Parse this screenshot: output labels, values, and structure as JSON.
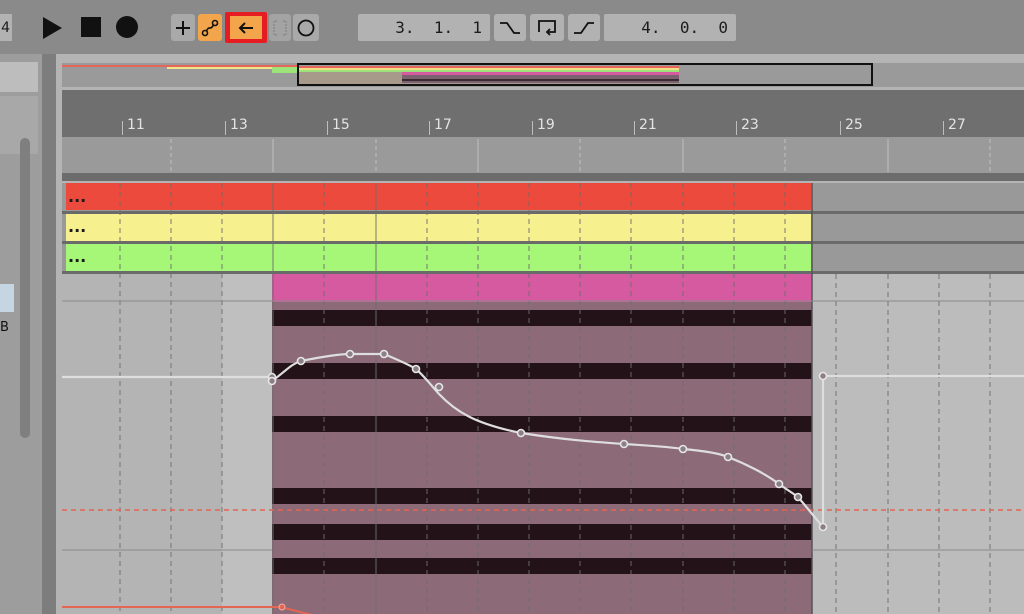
{
  "transport": {
    "meter_fragment": "4",
    "play_icon": "play-icon",
    "stop_icon": "stop-icon",
    "record_icon": "record-icon",
    "add_icon": "plus-icon",
    "automation_icon": "automation-draw-icon",
    "back_to_arrangement_icon": "arrow-left-icon",
    "punch_icon": "punch-bracket-icon",
    "loop_icon": "circle-icon",
    "position": "3.  1.  1",
    "punch_in_icon": "punch-in-icon",
    "loop_switch_icon": "loop-switch-icon",
    "punch_out_icon": "punch-out-icon",
    "length": "4.  0.  0",
    "highlight_color": "#e61c23",
    "active_color": "#f2a54a"
  },
  "left_strip": {
    "label": "B"
  },
  "ruler": {
    "bars": [
      "11",
      "13",
      "15",
      "17",
      "19",
      "21",
      "23",
      "25",
      "27"
    ]
  },
  "tracks": [
    {
      "label": "...",
      "color": "#ec4a3c"
    },
    {
      "label": "...",
      "color": "#f6f08f"
    },
    {
      "label": "...",
      "color": "#a6f778"
    }
  ],
  "clip": {
    "header_color": "#d55aa0",
    "body_color": "#8c6a78",
    "note_color": "#231318"
  },
  "automation": {
    "line_color": "#dedede",
    "threshold_color": "#e36552"
  }
}
